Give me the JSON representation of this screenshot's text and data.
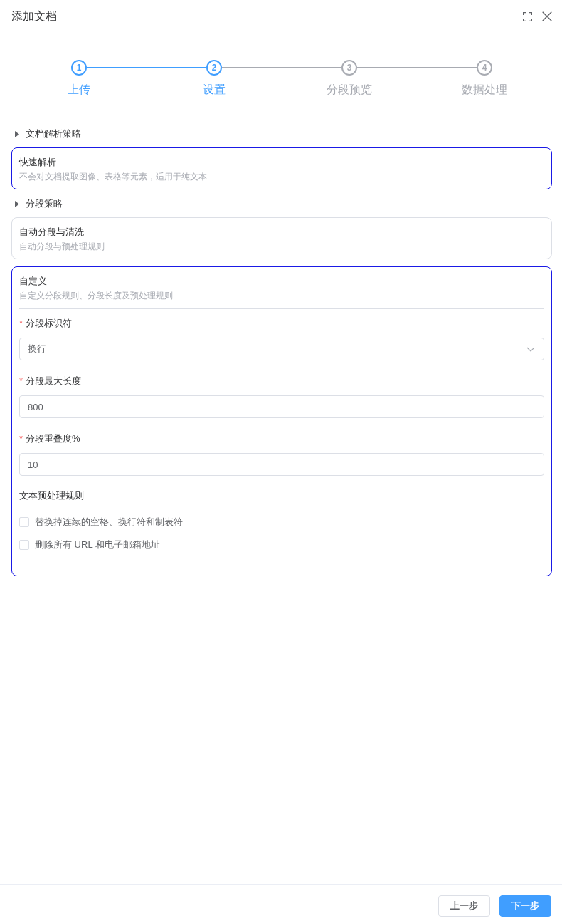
{
  "dialog": {
    "title": "添加文档"
  },
  "steps": [
    {
      "number": "1",
      "label": "上传",
      "active": true
    },
    {
      "number": "2",
      "label": "设置",
      "active": true
    },
    {
      "number": "3",
      "label": "分段预览",
      "active": false
    },
    {
      "number": "4",
      "label": "数据处理",
      "active": false
    }
  ],
  "sections": [
    {
      "title": "文档解析策略",
      "options": [
        {
          "title": "快速解析",
          "description": "不会对文档提取图像、表格等元素，适用于纯文本",
          "selected": true
        }
      ]
    },
    {
      "title": "分段策略",
      "options": [
        {
          "title": "自动分段与清洗",
          "description": "自动分段与预处理规则",
          "selected": false
        },
        {
          "title": "自定义",
          "description": "自定义分段规则、分段长度及预处理规则",
          "selected": true,
          "form": {
            "fields": [
              {
                "kind": "select",
                "required_mark": "*",
                "label": "分段标识符",
                "value": "换行"
              },
              {
                "kind": "input",
                "required_mark": "*",
                "label": "分段最大长度",
                "value": "800"
              },
              {
                "kind": "input",
                "required_mark": "*",
                "label": "分段重叠度%",
                "value": "10"
              }
            ],
            "rules": {
              "title": "文本预处理规则",
              "items": [
                {
                  "label": "替换掉连续的空格、换行符和制表符",
                  "checked": false
                },
                {
                  "label": "删除所有 URL 和电子邮箱地址",
                  "checked": false
                }
              ]
            }
          }
        }
      ]
    }
  ],
  "footer": {
    "buttons": [
      {
        "label": "上一步",
        "kind": "default"
      },
      {
        "label": "下一步",
        "kind": "primary"
      }
    ]
  }
}
